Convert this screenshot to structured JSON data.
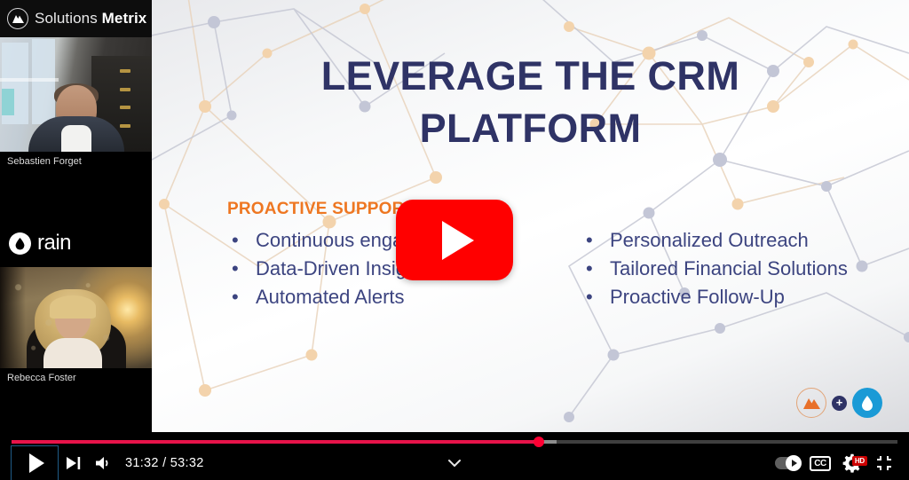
{
  "sidebar": {
    "brand1": {
      "name_light": "Solutions",
      "name_bold": "Metrix",
      "icon": "mountain-circle-icon"
    },
    "brand2": {
      "name": "rain",
      "icon": "water-drop-circle-icon"
    },
    "participants": [
      {
        "name": "Sebastien Forget"
      },
      {
        "name": "Rebecca Foster"
      }
    ]
  },
  "slide": {
    "title_line1": "LEVERAGE THE CRM",
    "title_line2": "PLATFORM",
    "title_color": "#2f3366",
    "section_heading": "PROACTIVE SUPPORT",
    "section_heading_color": "#ee7722",
    "bullets_left": [
      "Continuous engagement",
      "Data-Driven Insights",
      "Automated Alerts"
    ],
    "bullets_right": [
      "Personalized Outreach",
      "Tailored Financial Solutions",
      "Proactive Follow-Up"
    ],
    "footer_logos": {
      "left_icon": "solutions-metrix-mountain-icon",
      "plus": "+",
      "right_icon": "rain-water-drop-icon"
    }
  },
  "overlay": {
    "play_button": "play-button-large",
    "accent_color": "#ff0000"
  },
  "controls": {
    "play_label": "play-icon",
    "next_label": "next-video-icon",
    "volume_label": "volume-icon",
    "current_time": "31:32",
    "separator": "/",
    "duration": "53:32",
    "time_display": "31:32 / 53:32",
    "chevron_label": "chevron-down-icon",
    "autoplay_label": "autoplay-toggle",
    "cc_label": "CC",
    "settings_label": "settings-gear-icon",
    "quality_badge": "HD",
    "fullscreen_label": "exit-fullscreen-icon",
    "progress": {
      "played_percent": 58.9,
      "buffered_percent": 61.5,
      "played_color": "#e8134a",
      "knob_color": "#ff0033"
    }
  }
}
